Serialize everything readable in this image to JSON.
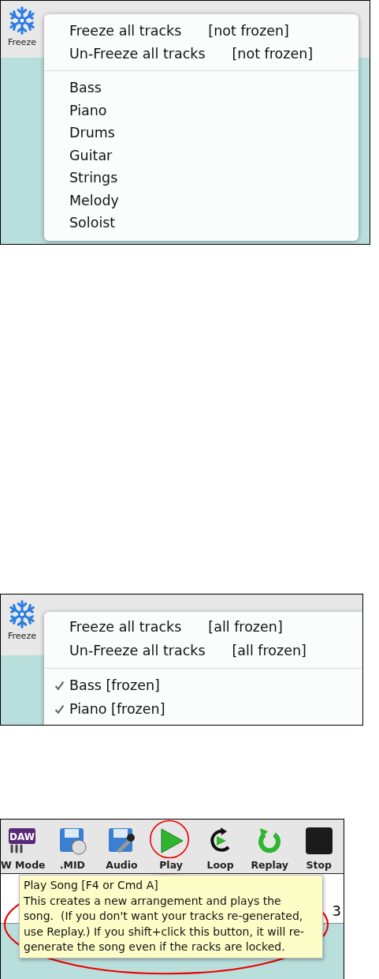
{
  "menu_panels": [
    {
      "toolbar_button": {
        "label": "Freeze"
      },
      "actions": [
        {
          "label": "Freeze all tracks",
          "status": "[not frozen]"
        },
        {
          "label": "Un-Freeze all tracks",
          "status": "[not frozen]"
        }
      ],
      "tracks": [
        {
          "label": "Bass",
          "checked": false
        },
        {
          "label": "Piano",
          "checked": false
        },
        {
          "label": "Drums",
          "checked": false
        },
        {
          "label": "Guitar",
          "checked": false
        },
        {
          "label": "Strings",
          "checked": false
        },
        {
          "label": "Melody",
          "checked": false
        },
        {
          "label": "Soloist",
          "checked": false
        }
      ]
    },
    {
      "toolbar_button": {
        "label": "Freeze"
      },
      "actions": [
        {
          "label": "Freeze all tracks",
          "status": "[all frozen]"
        },
        {
          "label": "Un-Freeze all tracks",
          "status": "[all frozen]"
        }
      ],
      "tracks": [
        {
          "label": "Bass [frozen]",
          "checked": true
        },
        {
          "label": "Piano [frozen]",
          "checked": true
        }
      ]
    }
  ],
  "toolbar_panel": {
    "buttons": [
      {
        "kind": "daw",
        "label": "W Mode",
        "icon_text": "DAW"
      },
      {
        "kind": "midi",
        "label": ".MID"
      },
      {
        "kind": "audio",
        "label": "Audio"
      },
      {
        "kind": "play",
        "label": "Play"
      },
      {
        "kind": "loop",
        "label": "Loop"
      },
      {
        "kind": "replay",
        "label": "Replay"
      },
      {
        "kind": "stop",
        "label": "Stop"
      }
    ],
    "row_value": "3",
    "tooltip": {
      "title": "Play Song [F4 or Cmd A]",
      "body": "This creates a new arrangement and plays the song.  (If you don't want your tracks re-generated, use Replay.) If you shift+click this button, it will re-generate the song even if the racks are locked."
    }
  }
}
